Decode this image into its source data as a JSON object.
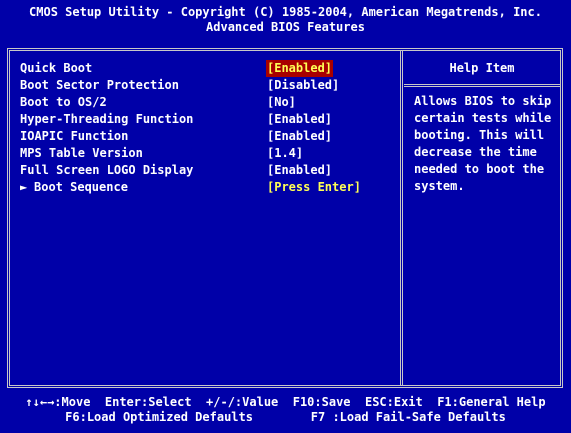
{
  "header": {
    "title": "CMOS Setup Utility - Copyright (C) 1985-2004, American Megatrends, Inc.",
    "subtitle": "Advanced BIOS Features"
  },
  "settings": [
    {
      "label": "Quick Boot",
      "value": "[Enabled]",
      "selected": true
    },
    {
      "label": "Boot Sector Protection",
      "value": "[Disabled]"
    },
    {
      "label": "Boot to OS/2",
      "value": "[No]"
    },
    {
      "label": "Hyper-Threading Function",
      "value": "[Enabled]"
    },
    {
      "label": "IOAPIC Function",
      "value": "[Enabled]"
    },
    {
      "label": "MPS Table Version",
      "value": "[1.4]"
    },
    {
      "label": "Full Screen LOGO Display",
      "value": "[Enabled]"
    },
    {
      "label": "Boot Sequence",
      "value": "[Press Enter]",
      "submenu": true,
      "arrow": "►"
    }
  ],
  "help": {
    "title": "Help Item",
    "lines": [
      "Allows BIOS to skip",
      "certain tests while",
      "booting. This will",
      "decrease the time",
      "needed to boot the",
      "system."
    ]
  },
  "footer": {
    "line1": "↑↓←→:Move  Enter:Select  +/-/:Value  F10:Save  ESC:Exit  F1:General Help",
    "line2": "F6:Load Optimized Defaults        F7 :Load Fail-Safe Defaults"
  },
  "colors": {
    "background": "#0000a8",
    "highlight_bg": "#a80000",
    "highlight_fg": "#ffff55",
    "text": "#ffffff",
    "border": "#c8c8c8"
  }
}
